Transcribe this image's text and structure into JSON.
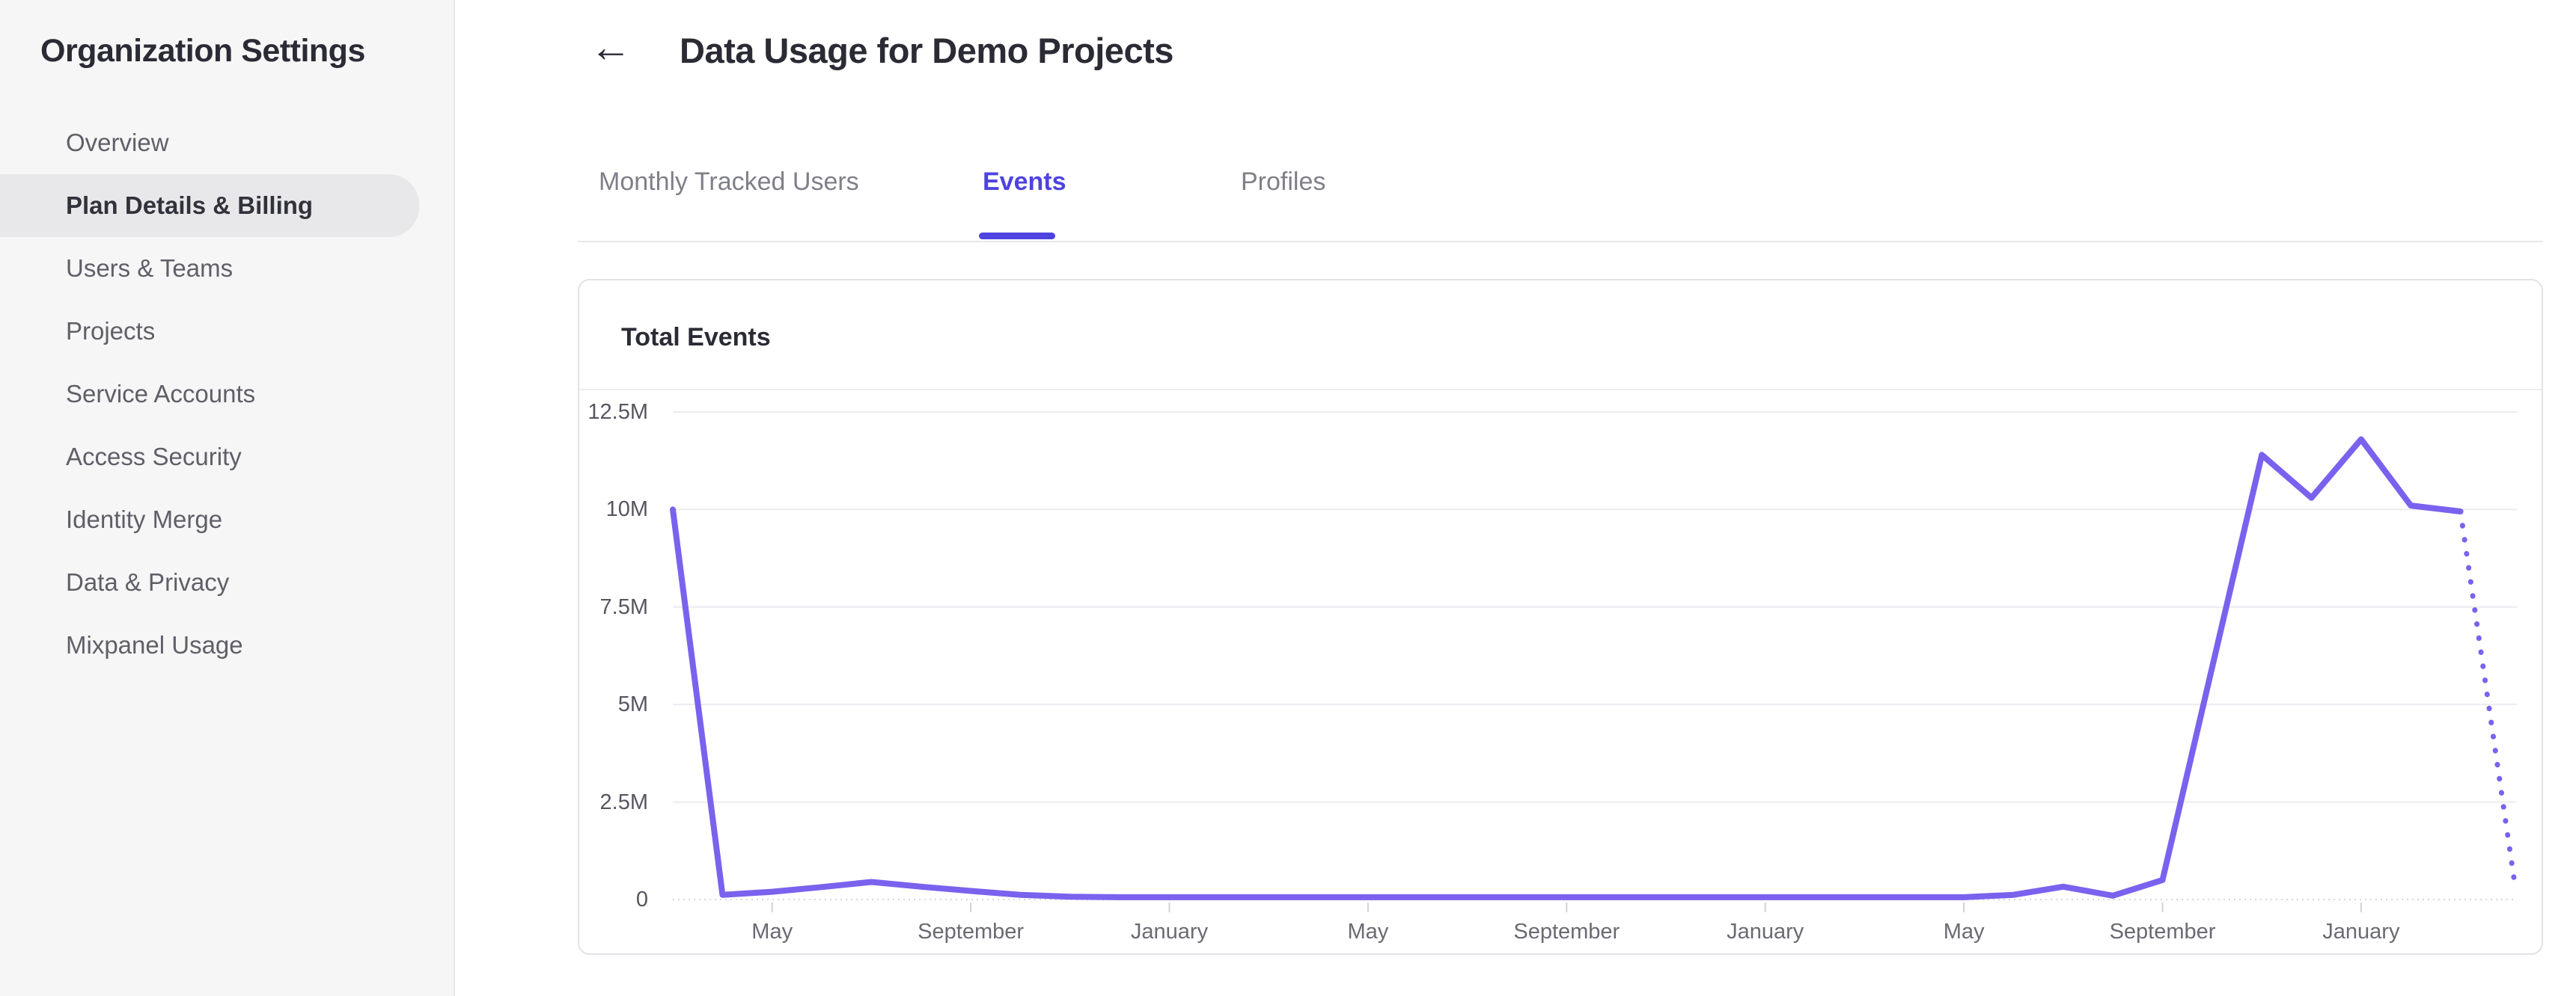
{
  "sidebar": {
    "title": "Organization Settings",
    "items": [
      {
        "label": "Overview",
        "selected": false
      },
      {
        "label": "Plan Details & Billing",
        "selected": true
      },
      {
        "label": "Users & Teams",
        "selected": false
      },
      {
        "label": "Projects",
        "selected": false
      },
      {
        "label": "Service Accounts",
        "selected": false
      },
      {
        "label": "Access Security",
        "selected": false
      },
      {
        "label": "Identity Merge",
        "selected": false
      },
      {
        "label": "Data & Privacy",
        "selected": false
      },
      {
        "label": "Mixpanel Usage",
        "selected": false
      }
    ]
  },
  "header": {
    "back_icon": "←",
    "title": "Data Usage for Demo Projects"
  },
  "tabs": [
    {
      "label": "Monthly Tracked Users",
      "active": false
    },
    {
      "label": "Events",
      "active": true
    },
    {
      "label": "Profiles",
      "active": false
    }
  ],
  "card": {
    "title": "Total Events"
  },
  "colors": {
    "accent": "#4e43e0",
    "line": "#7a62ee",
    "sidebar_bg": "#f6f6f7",
    "selected_item_bg": "#e8e8ea",
    "text_dark": "#2b2b35",
    "text_gray": "#5f5f68",
    "axis_label": "#565660",
    "gridline": "#ececf0",
    "axis_line": "#d7d7dd",
    "tick": "#d2d2d8"
  },
  "chart_data": {
    "type": "line",
    "title": "Total Events",
    "xlabel": "",
    "ylabel": "",
    "ylim": [
      0,
      12500000
    ],
    "grid": true,
    "legend": "none",
    "x_unit": "month",
    "y_ticks": [
      {
        "label": "12.5M",
        "value_millions": 12.5
      },
      {
        "label": "10M",
        "value_millions": 10
      },
      {
        "label": "7.5M",
        "value_millions": 7.5
      },
      {
        "label": "5M",
        "value_millions": 5
      },
      {
        "label": "2.5M",
        "value_millions": 2.5
      },
      {
        "label": "0",
        "value_millions": 0
      }
    ],
    "x_ticks": [
      {
        "label": "May",
        "month_index": 2
      },
      {
        "label": "September",
        "month_index": 6
      },
      {
        "label": "January",
        "month_index": 10
      },
      {
        "label": "May",
        "month_index": 14
      },
      {
        "label": "September",
        "month_index": 18
      },
      {
        "label": "January",
        "month_index": 22
      },
      {
        "label": "May",
        "month_index": 26
      },
      {
        "label": "September",
        "month_index": 30
      },
      {
        "label": "January",
        "month_index": 34
      }
    ],
    "series": [
      {
        "name": "Total Events",
        "unit": "millions of events per month",
        "values_millions": [
          10,
          0.12,
          0.2,
          0.32,
          0.45,
          0.33,
          0.22,
          0.12,
          0.07,
          0.06,
          0.06,
          0.06,
          0.06,
          0.06,
          0.06,
          0.06,
          0.06,
          0.06,
          0.06,
          0.06,
          0.06,
          0.06,
          0.06,
          0.06,
          0.06,
          0.06,
          0.06,
          0.12,
          0.33,
          0.1,
          0.5,
          5.95,
          11.4,
          10.3,
          11.8,
          10.1,
          9.95
        ]
      }
    ],
    "projection": {
      "style": "dotted",
      "from_month_index": 36,
      "to_month_index": 37.1,
      "to_value_millions": 0.35
    }
  }
}
